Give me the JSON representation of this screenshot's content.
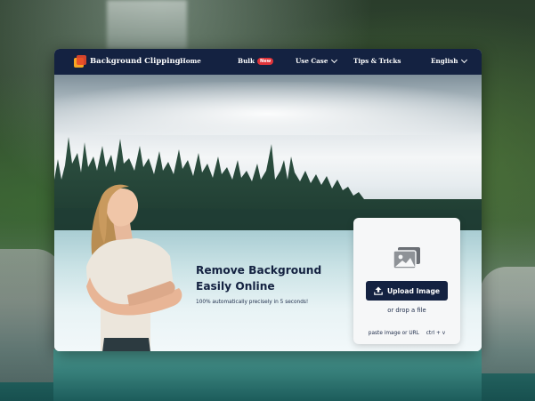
{
  "nav": {
    "brand": "Background Clipping",
    "items": [
      {
        "label": "Home"
      },
      {
        "label": "Bulk",
        "badge": "New"
      },
      {
        "label": "Use Case",
        "dropdown": true
      },
      {
        "label": "Tips & Tricks"
      },
      {
        "label": "English",
        "dropdown": true
      }
    ]
  },
  "hero": {
    "title_line1": "Remove Background",
    "title_line2": "Easily Online",
    "subtitle": "100% automatically precisely in 5 seconds!"
  },
  "upload": {
    "button_label": "Upload Image",
    "drop_text": "or drop a file",
    "paste_text": "paste image or URL",
    "shortcut": "ctrl + v"
  },
  "colors": {
    "navy": "#142241",
    "badge_red": "#e0343a",
    "logo_orange": "#f6a623",
    "logo_red": "#e8482a"
  },
  "icons": [
    "logo-mark-icon",
    "chevron-down-icon",
    "image-icon",
    "upload-icon"
  ]
}
